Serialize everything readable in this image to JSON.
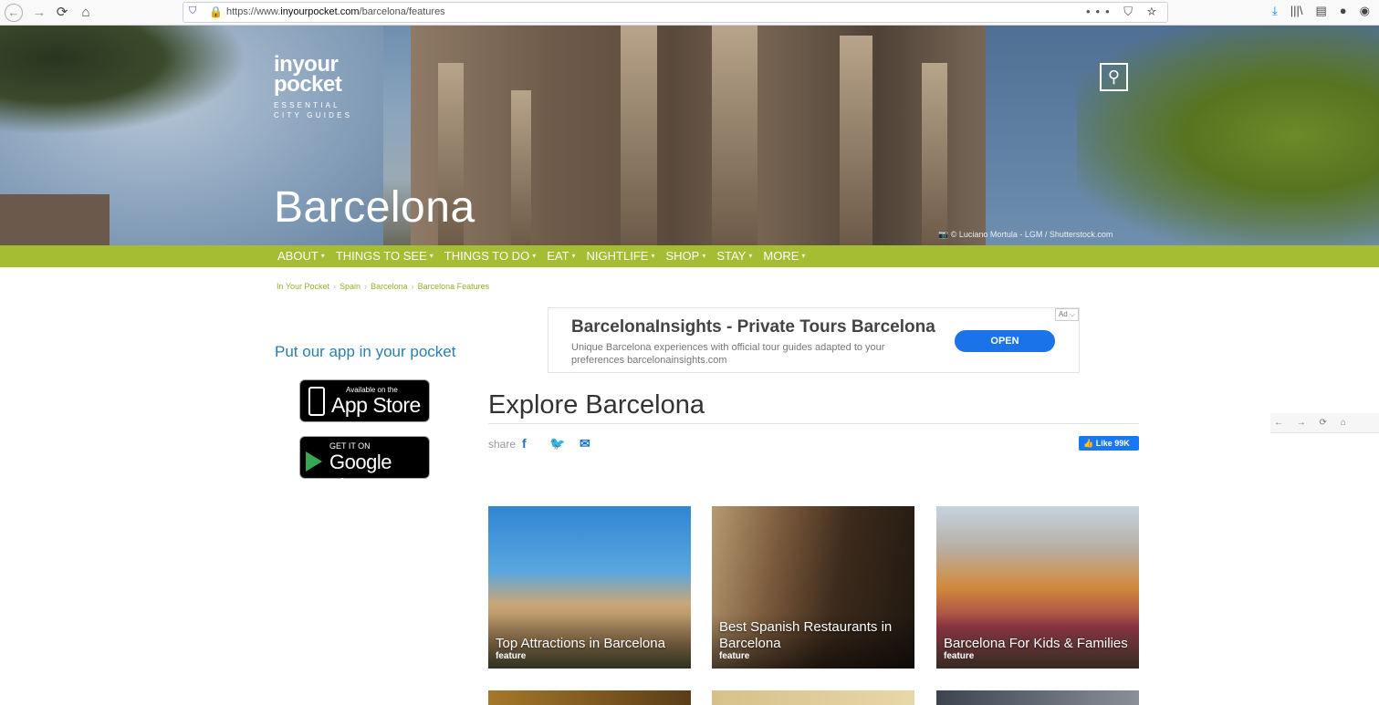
{
  "browser": {
    "back_icon": "←",
    "forward_icon": "→",
    "reload_icon": "⟳",
    "home_icon": "⌂",
    "url_prefix": "https://www.",
    "url_domain": "inyourpocket.com",
    "url_path": "/barcelona/features",
    "url_actions": "••• ⛉ ☆",
    "toolbar_icons": [
      "⤓",
      "|||\\",
      "▤",
      "●",
      "◉"
    ]
  },
  "hero": {
    "logo_line1": "inyour",
    "logo_line2": "pocket",
    "logo_tagline1": "ESSENTIAL",
    "logo_tagline2": "CITY GUIDES",
    "search_icon": "⚲",
    "city": "Barcelona",
    "photo_credit": "📷 © Luciano Mortula - LGM / Shutterstock.com"
  },
  "nav": {
    "caret": "▾",
    "items": [
      "ABOUT",
      "THINGS TO SEE",
      "THINGS TO DO",
      "EAT",
      "NIGHTLIFE",
      "SHOP",
      "STAY",
      "MORE"
    ]
  },
  "breadcrumb": {
    "sep": "›",
    "items": [
      "In Your Pocket",
      "Spain",
      "Barcelona",
      "Barcelona Features"
    ]
  },
  "sidebar": {
    "heading": "Put our app in your pocket",
    "app_store_small": "Available on the",
    "app_store_big": "App Store",
    "google_small": "GET IT ON",
    "google_big": "Google play"
  },
  "ad": {
    "title": "BarcelonaInsights - Private Tours Barcelona",
    "description": "Unique Barcelona experiences with official tour guides adapted to your preferences barcelonainsights.com",
    "button": "OPEN",
    "badge": "Ad ⌵"
  },
  "main": {
    "title": "Explore Barcelona",
    "share_label": "share",
    "share_icons": [
      "f",
      "🐦",
      "✉"
    ],
    "fb_like": "👍 Like 99K"
  },
  "cards": [
    {
      "title": "Top Attractions in Barcelona",
      "tag": "feature"
    },
    {
      "title": "Best Spanish Restaurants in Barcelona",
      "tag": "feature"
    },
    {
      "title": "Barcelona For Kids & Families",
      "tag": "feature"
    }
  ],
  "mini_toolbar": "← → ⟳ ⌂"
}
